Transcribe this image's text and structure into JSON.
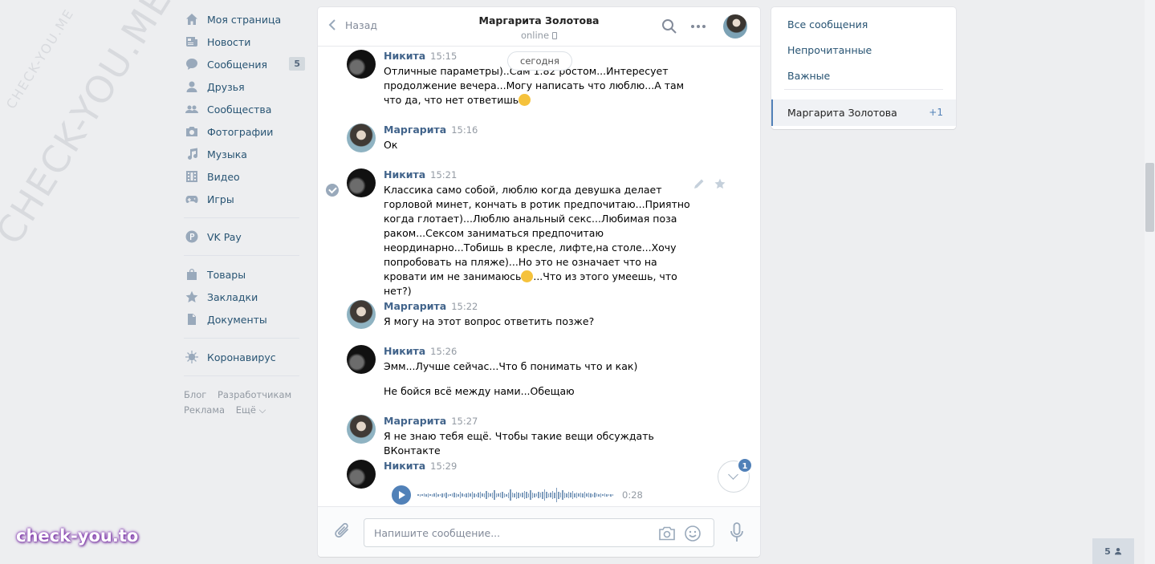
{
  "watermark": {
    "large": "CHECK-YOU.ME",
    "small": "CHECK-YOU.ME",
    "badge": "check-you.to"
  },
  "nav": {
    "items": [
      {
        "label": "Моя страница",
        "icon": "home-icon"
      },
      {
        "label": "Новости",
        "icon": "news-icon"
      },
      {
        "label": "Сообщения",
        "icon": "messages-icon",
        "badge": "5"
      },
      {
        "label": "Друзья",
        "icon": "friends-icon"
      },
      {
        "label": "Сообщества",
        "icon": "groups-icon"
      },
      {
        "label": "Фотографии",
        "icon": "camera-icon"
      },
      {
        "label": "Музыка",
        "icon": "music-icon"
      },
      {
        "label": "Видео",
        "icon": "video-icon"
      },
      {
        "label": "Игры",
        "icon": "games-icon"
      },
      {
        "label": "VK Pay",
        "icon": "vkpay-icon"
      },
      {
        "label": "Товары",
        "icon": "shopping-bag-icon"
      },
      {
        "label": "Закладки",
        "icon": "star-icon"
      },
      {
        "label": "Документы",
        "icon": "document-icon"
      },
      {
        "label": "Коронавирус",
        "icon": "virus-icon"
      }
    ],
    "footer": {
      "blog": "Блог",
      "developers": "Разработчикам",
      "ads": "Реклама",
      "more": "Ещё ⌵"
    }
  },
  "chat": {
    "back_label": "Назад",
    "title": "Маргарита Золотова",
    "status": "online",
    "date_divider": "сегодня",
    "messages": [
      {
        "author": "Никита",
        "time": "15:15",
        "text": "Отличные параметры)..Сам 1.82 ростом...Интересует продолжение вечера...Могу написать что люблю...А там что да, что нет ответишь"
      },
      {
        "author": "Маргарита",
        "time": "15:16",
        "text": "Ок"
      },
      {
        "author": "Никита",
        "time": "15:21",
        "text": "Классика само собой, люблю когда девушка делает горловой минет, кончать в ротик предпочитаю...Приятно когда глотает)...Люблю анальный секс...Любимая поза раком...Сексом заниматься предпочитаю неординарно...Тобишь в кресле, лифте,на столе...Хочу попробовать на пляже)...Но это не означает что на кровати им не занимаюсь",
        "text_tail": "...Что из этого умеешь, что нет?)"
      },
      {
        "author": "Маргарита",
        "time": "15:22",
        "text": "Я могу на этот вопрос ответить позже?"
      },
      {
        "author": "Никита",
        "time": "15:26",
        "text": "Эмм...Лучше сейчас...Что б понимать что и как)",
        "text2": "Не бойся всё между нами...Обещаю"
      },
      {
        "author": "Маргарита",
        "time": "15:27",
        "text": "Я не знаю тебя ещё. Чтобы такие вещи обсуждать ВКонтакте"
      },
      {
        "author": "Никита",
        "time": "15:29",
        "audio_duration": "0:28"
      }
    ],
    "scroll_badge": "1",
    "input_placeholder": "Напишите сообщение..."
  },
  "right_panel": {
    "all": "Все сообщения",
    "unread": "Непрочитанные",
    "important": "Важные",
    "active_name": "Маргарита Золотова",
    "active_count": "+1"
  },
  "friends_online": "5",
  "colors": {
    "accent": "#5181b8",
    "link": "#285473",
    "author": "#42648b",
    "background": "#edeef0"
  }
}
